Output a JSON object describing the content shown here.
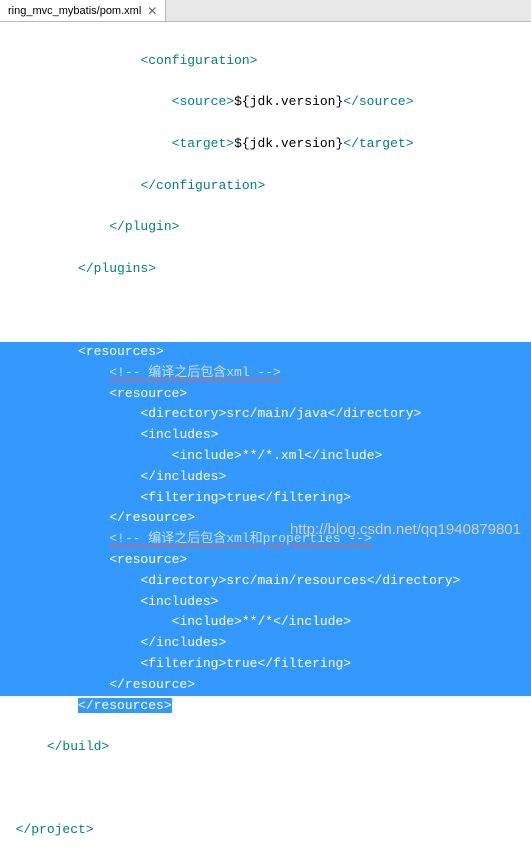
{
  "tab": {
    "label": "ring_mvc_mybatis/pom.xml",
    "close": "✕"
  },
  "code": {
    "l1_open": "<configuration>",
    "l2_open": "<source>",
    "l2_val": "${jdk.version}",
    "l2_close": "</source>",
    "l3_open": "<target>",
    "l3_val": "${jdk.version}",
    "l3_close": "</target>",
    "l4": "</configuration>",
    "l5": "</plugin>",
    "l6": "</plugins>",
    "l7": "<resources>",
    "l8": "<!-- 编译之后包含xml -->",
    "l9": "<resource>",
    "l10_open": "<directory>",
    "l10_val": "src/main/java",
    "l10_close": "</directory>",
    "l11": "<includes>",
    "l12_open": "<include>",
    "l12_val": "**/*.xml",
    "l12_close": "</include>",
    "l13": "</includes>",
    "l14_open": "<filtering>",
    "l14_val": "true",
    "l14_close": "</filtering>",
    "l15": "</resource>",
    "l16": "<!-- 编译之后包含xml和properties -->",
    "l17": "<resource>",
    "l18_open": "<directory>",
    "l18_val": "src/main/resources",
    "l18_close": "</directory>",
    "l19": "<includes>",
    "l20_open": "<include>",
    "l20_val": "**/*",
    "l20_close": "</include>",
    "l21": "</includes>",
    "l22_open": "<filtering>",
    "l22_val": "true",
    "l22_close": "</filtering>",
    "l23": "</resource>",
    "l24": "</resources>",
    "l25": "</build>",
    "l26": "</project>"
  },
  "watermark": "http://blog.csdn.net/qq1940879801"
}
